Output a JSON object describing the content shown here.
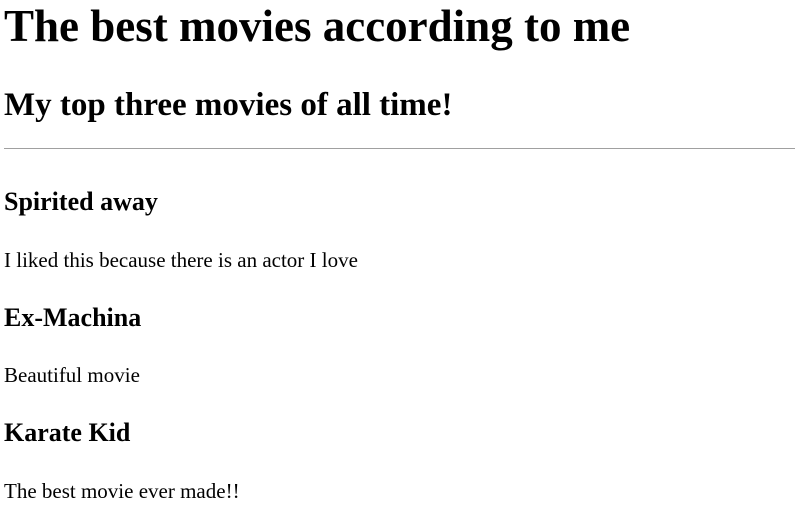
{
  "page": {
    "title": "The best movies according to me",
    "subtitle": "My top three movies of all time!"
  },
  "movies": [
    {
      "title": "Spirited away",
      "description": "I liked this because there is an actor I love"
    },
    {
      "title": "Ex-Machina",
      "description": "Beautiful movie"
    },
    {
      "title": "Karate Kid",
      "description": "The best movie ever made!!"
    }
  ]
}
